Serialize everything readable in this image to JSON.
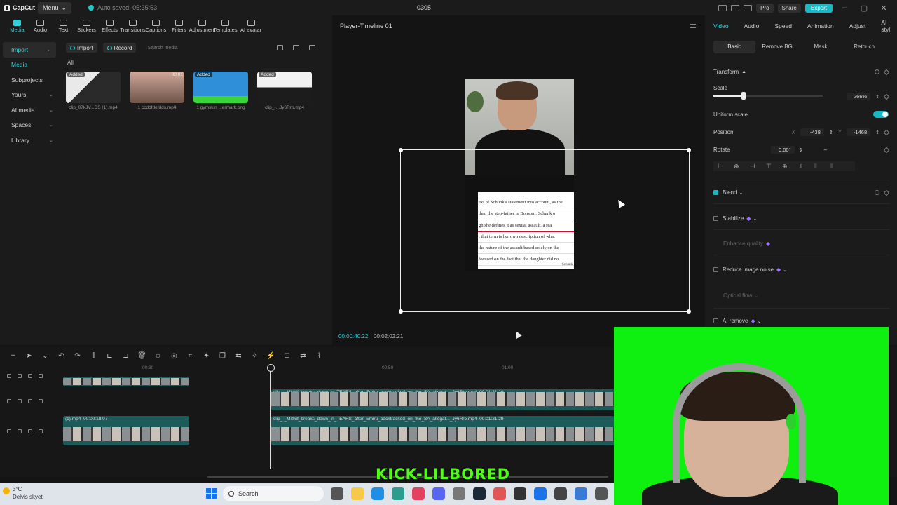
{
  "app": {
    "logo_text": "CapCut",
    "menu_label": "Menu",
    "autosave": "Auto saved: 05:35:53",
    "title": "0305",
    "pro_label": "Pro",
    "share_label": "Share",
    "export_label": "Export",
    "accent_color": "#19b8c4"
  },
  "toolbar": {
    "tools": [
      "Media",
      "Audio",
      "Text",
      "Stickers",
      "Effects",
      "Transitions",
      "Captions",
      "Filters",
      "Adjustment",
      "Templates",
      "AI avatar"
    ],
    "active": "Media"
  },
  "left_nav": {
    "items": [
      {
        "label": "Import",
        "state": "active"
      },
      {
        "label": "Media",
        "state": "sub"
      },
      {
        "label": "Subprojects",
        "state": ""
      },
      {
        "label": "Yours",
        "state": "chev"
      },
      {
        "label": "AI media",
        "state": "chev"
      },
      {
        "label": "Spaces",
        "state": "chev"
      },
      {
        "label": "Library",
        "state": "chev"
      }
    ]
  },
  "media_bar": {
    "import_label": "Import",
    "record_label": "Record",
    "search_placeholder": "Search media",
    "all_label": "All"
  },
  "media": [
    {
      "name": "clip_07kJV...DS (1).mp4",
      "badge": "Added",
      "duration": ""
    },
    {
      "name": "1 ccddfdefdds.mp4",
      "badge": "",
      "duration": "00:01"
    },
    {
      "name": "1 gymskin ...ermark.png",
      "badge": "Added",
      "duration": ""
    },
    {
      "name": "clip_-...Jy6Rro.mp4",
      "badge": "Added",
      "duration": ""
    }
  ],
  "player": {
    "title": "Player-Timeline 01",
    "current_time": "00:00:40:22",
    "total_time": "00:02:02:21",
    "doc_lines": [
      "ext of Schunk's statement into account, as the",
      "than the step-father in Bonsoni.  Schunk o",
      "gh she defines it as sexual assault, a rea",
      "t that term is her own description of what",
      "the nature of the assault based solely on the",
      "focused on the fact that the daughter did no"
    ],
    "doc_page": "Schunk"
  },
  "right_panel": {
    "tabs": [
      "Video",
      "Audio",
      "Speed",
      "Animation",
      "Adjust",
      "AI styl"
    ],
    "active_tab": "Video",
    "subtabs": [
      "Basic",
      "Remove BG",
      "Mask",
      "Retouch"
    ],
    "active_subtab": "Basic",
    "transform_label": "Transform",
    "scale_label": "Scale",
    "scale_value": "266%",
    "scale_fraction": 0.5,
    "uniform_scale_label": "Uniform scale",
    "position_label": "Position",
    "pos_x_label": "X",
    "pos_x": "-438",
    "pos_y_label": "Y",
    "pos_y": "-1468",
    "rotate_label": "Rotate",
    "rotate_value": "0.00°",
    "rotate_extra": "–",
    "blend_label": "Blend",
    "stabilize_label": "Stabilize",
    "enhance_label": "Enhance quality",
    "reduce_noise_label": "Reduce image noise",
    "optical_flow_label": "Optical flow",
    "ai_remove_label": "AI remove"
  },
  "timeline": {
    "ruler": [
      "00:30",
      "00:50",
      "01:00"
    ],
    "clips": [
      {
        "track": 1,
        "name": "",
        "duration": ""
      },
      {
        "track": 1,
        "name": "clip_-_Mizkif_breaks_down_in_TEARS_after_Emiru_backtracked_on_the_SA_allegat..._Jy6Rro.mp4",
        "duration": "00:01:21:29"
      },
      {
        "track": 2,
        "name": "(1).mp4",
        "duration": "00:00:18:07"
      },
      {
        "track": 2,
        "name": "clip_-_Mizkif_breaks_down_in_TEARS_after_Emiru_backtracked_on_the_SA_allegat..._Jy6Rro.mp4",
        "duration": "00:01:21:29"
      }
    ]
  },
  "overlay": {
    "kick_label": "KICK-LILBORED",
    "green_color": "#10f010"
  },
  "taskbar": {
    "temp": "3°C",
    "weather": "Delvis skyet",
    "search_label": "Search",
    "apps": [
      "file-explorer",
      "terminal",
      "folder",
      "edge",
      "store",
      "chrome",
      "discord",
      "calculator",
      "steam",
      "capcut",
      "crossmark",
      "notepad",
      "media-player",
      "vscode"
    ]
  }
}
